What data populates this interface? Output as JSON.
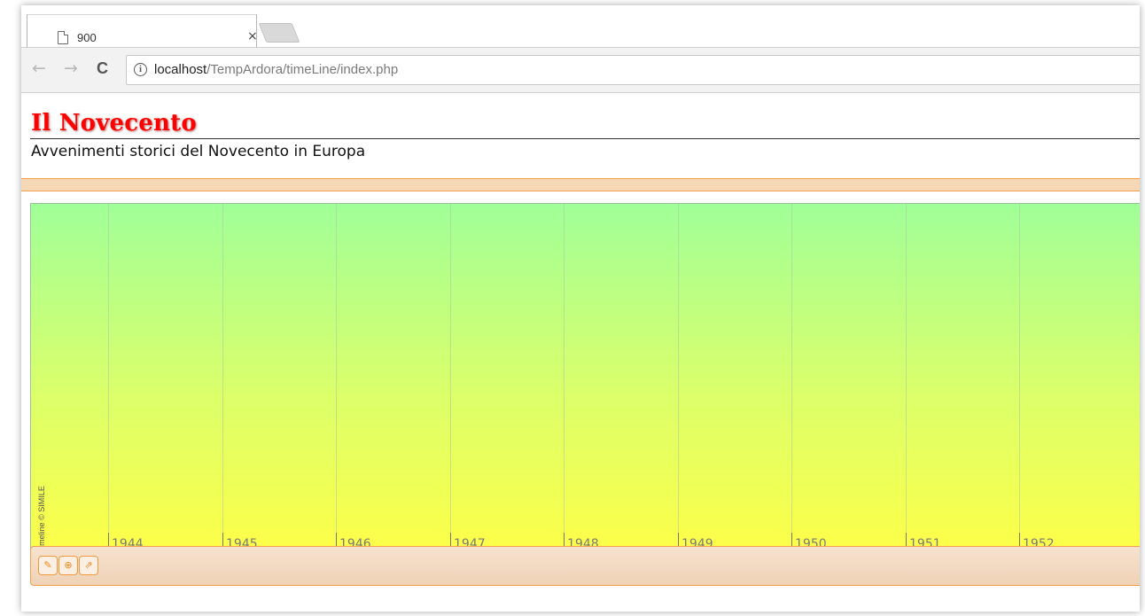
{
  "browser": {
    "tab_title": "900",
    "tab_close": "×",
    "url_host": "localhost",
    "url_path": "/TempArdora/timeLine/index.php",
    "back_glyph": "←",
    "forward_glyph": "→",
    "reload_glyph": "C",
    "info_glyph": "i"
  },
  "page": {
    "title": "Il Novecento",
    "subtitle": "Avvenimenti storici del Novecento in Europa"
  },
  "timeline": {
    "years": [
      "1944",
      "1945",
      "1946",
      "1947",
      "1948",
      "1949",
      "1950",
      "1951",
      "1952"
    ],
    "credit": "Timeline © SIMILE",
    "gradient_top": "#a0ff98",
    "gradient_bottom": "#fdff48",
    "controls": [
      {
        "icon": "edit-icon",
        "glyph": "✎"
      },
      {
        "icon": "filter-icon",
        "glyph": "⊕"
      },
      {
        "icon": "external-link-icon",
        "glyph": "⇗"
      }
    ]
  },
  "colors": {
    "title": "#ff0000",
    "accent_orange": "#f0a050"
  }
}
